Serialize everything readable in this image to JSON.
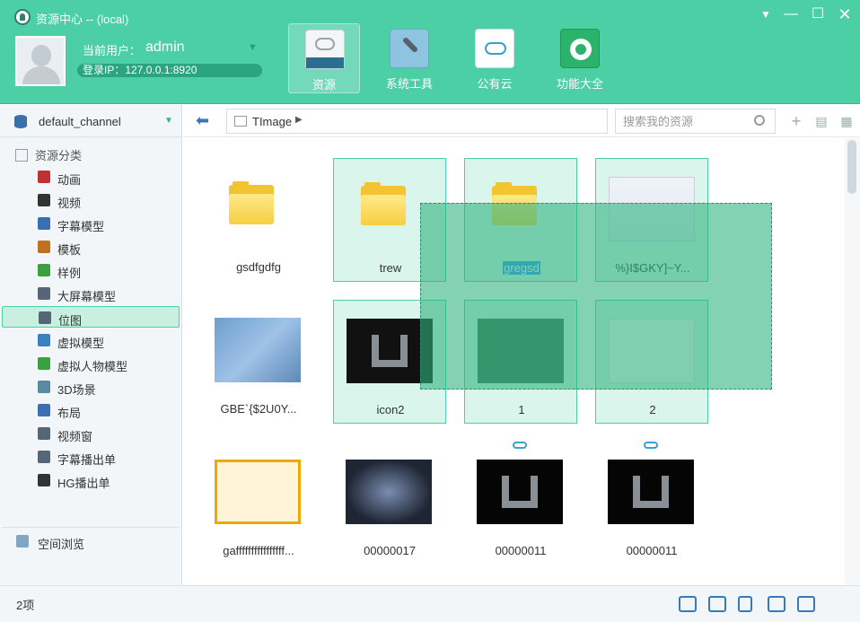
{
  "window": {
    "title": "资源中心 -- (local)",
    "controls": {
      "dropdown": "▼",
      "minimize": "—",
      "maximize": "☐",
      "close": "✕"
    }
  },
  "user": {
    "label": "当前用户：",
    "name": "admin",
    "login_ip": "登录IP：127.0.0.1:8920"
  },
  "toolbar": [
    {
      "label": "资源",
      "icon": "resources-icon",
      "active": true
    },
    {
      "label": "系统工具",
      "icon": "system-tools-icon",
      "active": false
    },
    {
      "label": "公有云",
      "icon": "public-cloud-icon",
      "active": false
    },
    {
      "label": "功能大全",
      "icon": "functions-icon",
      "active": false
    }
  ],
  "sidebar": {
    "channel": "default_channel",
    "category_header": "资源分类",
    "items": [
      {
        "label": "动画",
        "icon": "animation-icon",
        "color": "#c03030"
      },
      {
        "label": "视频",
        "icon": "video-icon",
        "color": "#333333"
      },
      {
        "label": "字幕模型",
        "icon": "subtitle-model-icon",
        "color": "#3a6fb0"
      },
      {
        "label": "模板",
        "icon": "template-icon",
        "color": "#c07020"
      },
      {
        "label": "样例",
        "icon": "sample-icon",
        "color": "#3aa040"
      },
      {
        "label": "大屏幕模型",
        "icon": "big-screen-icon",
        "color": "#556677"
      },
      {
        "label": "位图",
        "icon": "bitmap-icon",
        "color": "#556677",
        "selected": true
      },
      {
        "label": "虚拟模型",
        "icon": "virtual-model-icon",
        "color": "#3a80c0"
      },
      {
        "label": "虚拟人物模型",
        "icon": "virtual-person-icon",
        "color": "#3aa040"
      },
      {
        "label": "3D场景",
        "icon": "3d-scene-icon",
        "color": "#5a8aa0"
      },
      {
        "label": "布局",
        "icon": "layout-icon",
        "color": "#3a6fb0"
      },
      {
        "label": "视频窗",
        "icon": "video-window-icon",
        "color": "#556677"
      },
      {
        "label": "字幕播出单",
        "icon": "subtitle-playlist-icon",
        "color": "#556677"
      },
      {
        "label": "HG播出单",
        "icon": "headphones-icon",
        "color": "#333333"
      }
    ],
    "space_browse": "空间浏览"
  },
  "pathbar": {
    "path": "TImage",
    "search_placeholder": "搜索我的资源"
  },
  "tiles": [
    {
      "name": "gsdfgdfg",
      "kind": "folder",
      "selected": false
    },
    {
      "name": "trew",
      "kind": "folder",
      "selected": true
    },
    {
      "name": "gregsd",
      "kind": "folder",
      "selected": true,
      "renaming": true
    },
    {
      "name": "%}I$GKY]~Y...",
      "kind": "img-screenshot",
      "selected": true
    },
    {
      "name": "GBE`{$2U0Y...",
      "kind": "img-blue",
      "selected": false
    },
    {
      "name": "icon2",
      "kind": "img-icon2",
      "selected": true
    },
    {
      "name": "1",
      "kind": "img-green",
      "selected": true
    },
    {
      "name": "2",
      "kind": "img-doc",
      "selected": true
    },
    {
      "name": "gaffffffffffffffff...",
      "kind": "img-orange",
      "selected": false
    },
    {
      "name": "00000017",
      "kind": "img-grid",
      "selected": false
    },
    {
      "name": "00000011",
      "kind": "img-dark",
      "selected": false,
      "linked": true
    },
    {
      "name": "00000011",
      "kind": "img-dark",
      "selected": false,
      "linked": true
    }
  ],
  "status": {
    "count": "2项"
  },
  "colors": {
    "accent": "#4ccfa5",
    "selection_fill": "#d9f5ec",
    "drag_rect": "#30b482"
  }
}
